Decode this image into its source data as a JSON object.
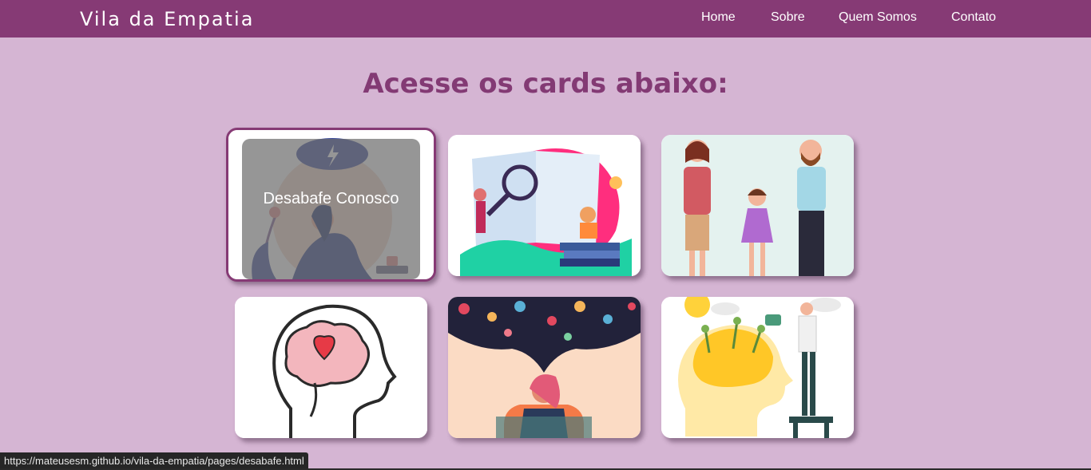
{
  "nav": {
    "brand": "Vila da Empatia",
    "links": [
      "Home",
      "Sobre",
      "Quem Somos",
      "Contato"
    ]
  },
  "main": {
    "heading": "Acesse os cards abaixo:",
    "cards": [
      {
        "illustration": "woman-sad-under-cloud",
        "overlay_label": "Desabafe Conosco",
        "hovered": true
      },
      {
        "illustration": "book-magnifier-people"
      },
      {
        "illustration": "family-holding-hands"
      },
      {
        "illustration": "brain-heart-head"
      },
      {
        "illustration": "woman-anxious-thoughts"
      },
      {
        "illustration": "watering-brain-plants"
      }
    ]
  },
  "status_bar": {
    "url": "https://mateusesm.github.io/vila-da-empatia/pages/desabafe.html"
  },
  "colors": {
    "navbar": "#863a75",
    "background": "#d5b5d3",
    "heading": "#833a74"
  }
}
